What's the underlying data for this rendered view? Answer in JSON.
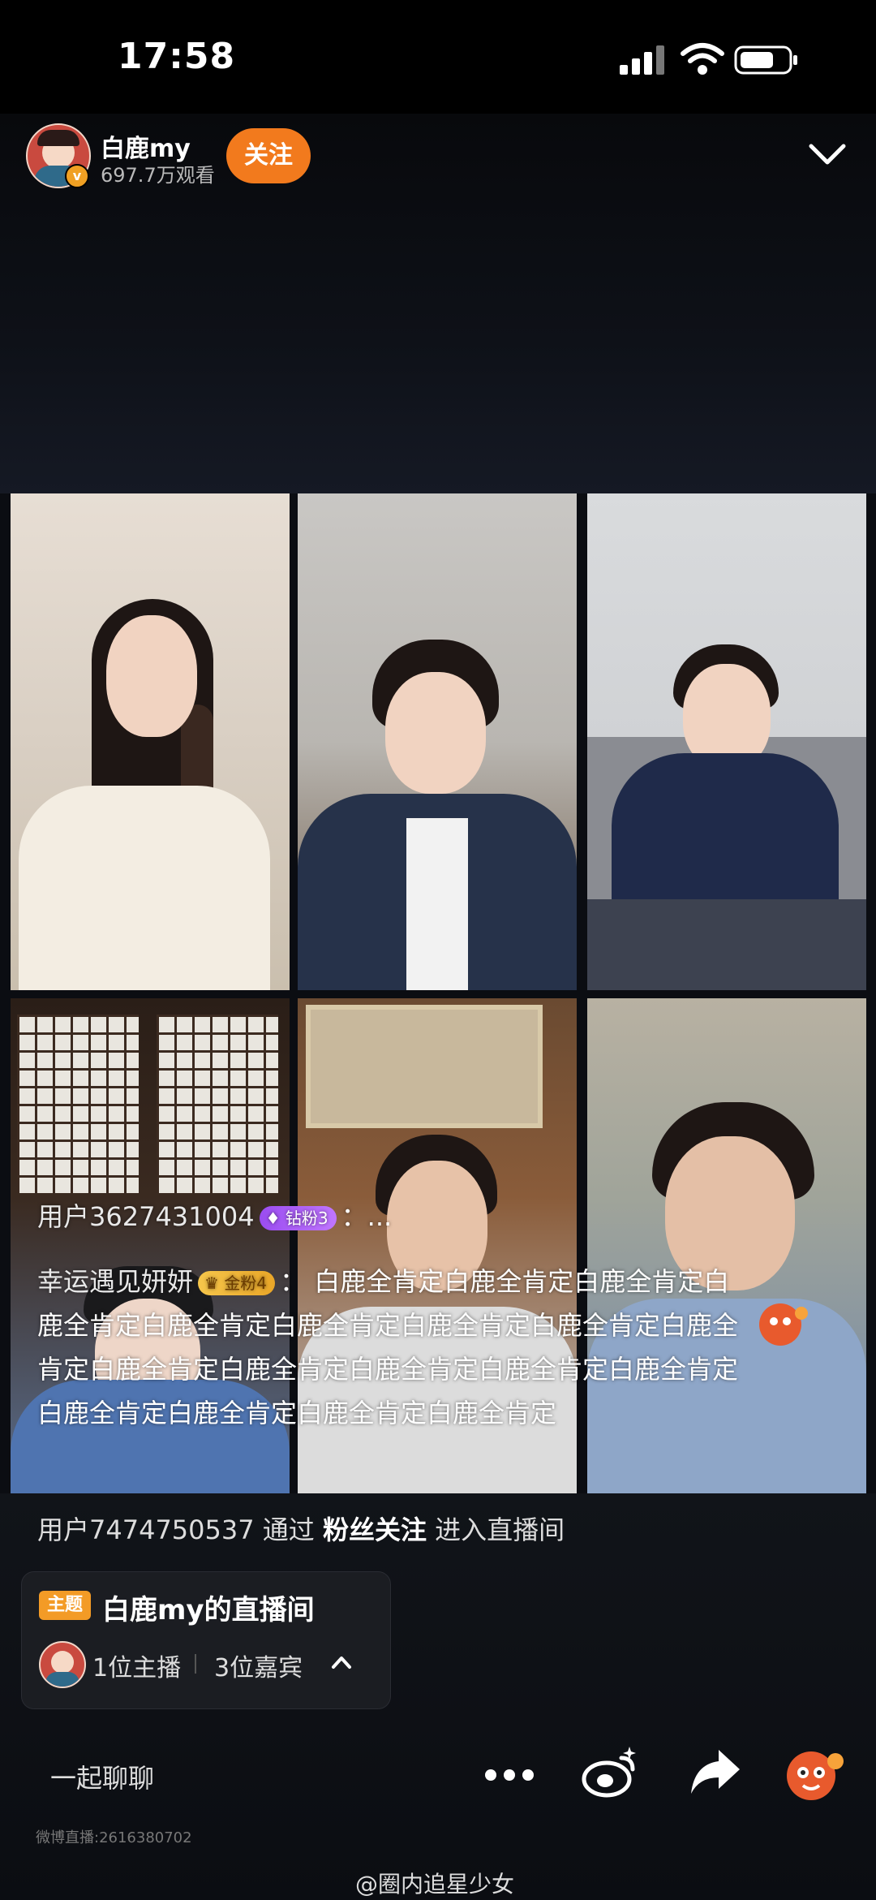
{
  "status_bar": {
    "time": "17:58"
  },
  "header": {
    "host_name": "白鹿my",
    "view_count": "697.7万观看",
    "follow_label": "关注",
    "verified_mark": "v"
  },
  "comments": [
    {
      "user": "用户3627431004",
      "badge": "钻粉3",
      "text": "：..."
    },
    {
      "user": "幸运遇见妍妍",
      "badge": "金粉4",
      "text": "： 白鹿全肯定白鹿全肯定白鹿全肯定白鹿全肯定白鹿全肯定白鹿全肯定白鹿全肯定白鹿全肯定白鹿全肯定白鹿全肯定白鹿全肯定白鹿全肯定白鹿全肯定白鹿全肯定白鹿全肯定白鹿全肯定白鹿全肯定白鹿全肯定"
    }
  ],
  "entry_notice": {
    "user": "用户7474750537",
    "via": "通过",
    "source": "粉丝关注",
    "action": "进入直播间"
  },
  "room_card": {
    "tag": "主题",
    "title": "白鹿my的直播间",
    "host_count": "1位主播",
    "guest_count": "3位嘉宾"
  },
  "bottom_bar": {
    "chat_label": "一起聊聊"
  },
  "footer": {
    "room_id": "微博直播:2616380702",
    "watermark": "@圈内追星少女"
  },
  "colors": {
    "accent": "#f27a1d",
    "tag": "#f39b26",
    "background": "#0b0d12"
  },
  "icons": [
    "signal-icon",
    "wifi-icon",
    "battery-icon",
    "chevron-down-icon",
    "more-icon",
    "weibo-icon",
    "share-icon",
    "gift-icon",
    "chevron-up-icon"
  ]
}
